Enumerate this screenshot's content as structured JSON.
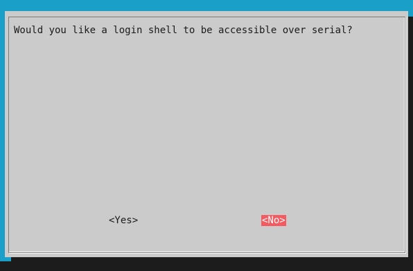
{
  "dialog": {
    "message": "Would you like a login shell to be accessible over serial?",
    "buttons": {
      "yes_label": "<Yes>",
      "no_label": "<No>"
    },
    "selected_button": "no"
  },
  "colors": {
    "terminal_background": "#1aa0c8",
    "dialog_background": "#cbcbcb",
    "shadow": "#1c1c1c",
    "selected_button_background": "#f45a5f",
    "selected_button_text": "#ffffff",
    "text": "#1a1a1a"
  }
}
